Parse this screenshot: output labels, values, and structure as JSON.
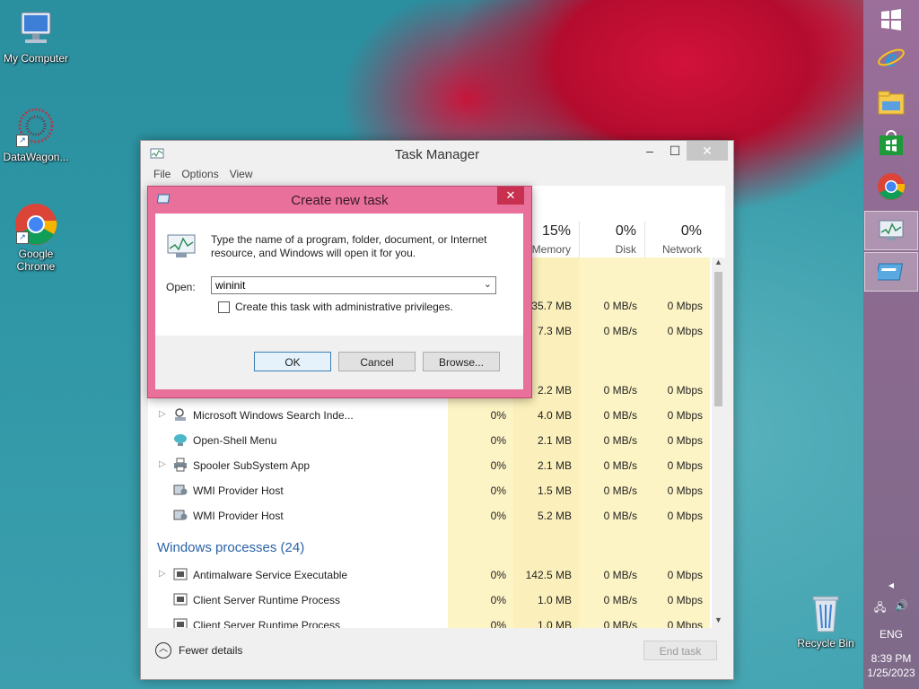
{
  "desktop": {
    "icons": [
      {
        "label": "My Computer"
      },
      {
        "label": "DataWagon..."
      },
      {
        "label": "Google Chrome"
      },
      {
        "label": "Recycle Bin"
      }
    ]
  },
  "tray": {
    "language": "ENG",
    "time": "8:39 PM",
    "date": "1/25/2023"
  },
  "task_manager": {
    "title": "Task Manager",
    "menu": [
      "File",
      "Options",
      "View"
    ],
    "columns": [
      {
        "percent": "15%",
        "label": "Memory"
      },
      {
        "percent": "0%",
        "label": "Disk"
      },
      {
        "percent": "0%",
        "label": "Network"
      }
    ],
    "partial_rows": [
      {
        "mem": "35.7 MB",
        "disk": "0 MB/s",
        "net": "0 Mbps"
      },
      {
        "mem": "7.3 MB",
        "disk": "0 MB/s",
        "net": "0 Mbps"
      },
      {
        "mem": "2.2 MB",
        "disk": "0 MB/s",
        "net": "0 Mbps"
      }
    ],
    "rows": [
      {
        "name": "Microsoft Windows Search Inde...",
        "cpu": "0%",
        "mem": "4.0 MB",
        "disk": "0 MB/s",
        "net": "0 Mbps"
      },
      {
        "name": "Open-Shell Menu",
        "cpu": "0%",
        "mem": "2.1 MB",
        "disk": "0 MB/s",
        "net": "0 Mbps"
      },
      {
        "name": "Spooler SubSystem App",
        "cpu": "0%",
        "mem": "2.1 MB",
        "disk": "0 MB/s",
        "net": "0 Mbps"
      },
      {
        "name": "WMI Provider Host",
        "cpu": "0%",
        "mem": "1.5 MB",
        "disk": "0 MB/s",
        "net": "0 Mbps"
      },
      {
        "name": "WMI Provider Host",
        "cpu": "0%",
        "mem": "5.2 MB",
        "disk": "0 MB/s",
        "net": "0 Mbps"
      }
    ],
    "group_title": "Windows processes (24)",
    "rows2": [
      {
        "name": "Antimalware Service Executable",
        "cpu": "0%",
        "mem": "142.5 MB",
        "disk": "0 MB/s",
        "net": "0 Mbps"
      },
      {
        "name": "Client Server Runtime Process",
        "cpu": "0%",
        "mem": "1.0 MB",
        "disk": "0 MB/s",
        "net": "0 Mbps"
      },
      {
        "name": "Client Server Runtime Process",
        "cpu": "0%",
        "mem": "1.0 MB",
        "disk": "0 MB/s",
        "net": "0 Mbps"
      }
    ],
    "fewer_details": "Fewer details",
    "end_task": "End task"
  },
  "dialog": {
    "title": "Create new task",
    "description": "Type the name of a program, folder, document, or Internet resource, and Windows will open it for you.",
    "open_label": "Open:",
    "open_value": "wininit",
    "admin_checkbox_label": "Create this task with administrative privileges.",
    "admin_checked": false,
    "ok": "OK",
    "cancel": "Cancel",
    "browse": "Browse..."
  }
}
